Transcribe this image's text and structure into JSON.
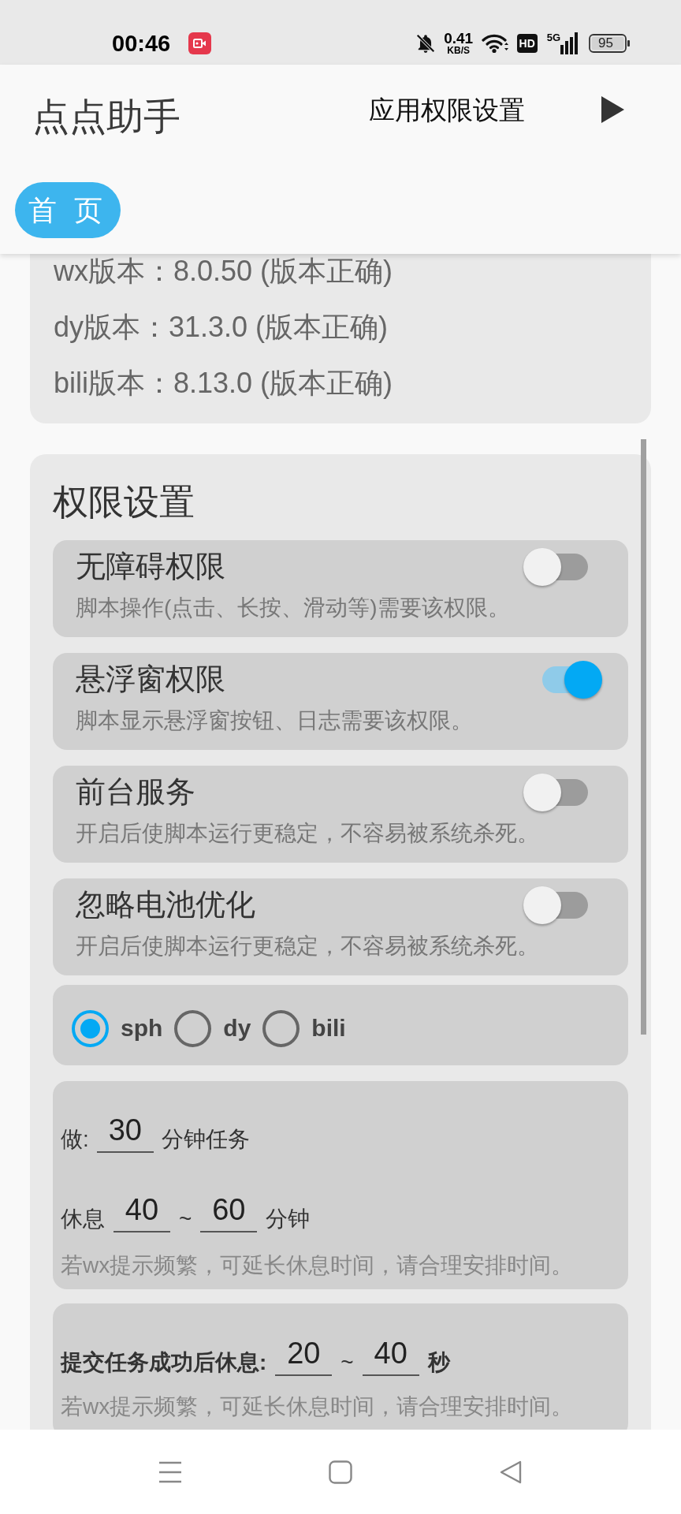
{
  "status_bar": {
    "time": "00:46",
    "net_speed": "0.41",
    "net_speed_unit": "KB/S",
    "hd": "HD",
    "network": "5G",
    "battery": "95"
  },
  "app_bar": {
    "title": "点点助手",
    "page_title": "应用权限设置"
  },
  "tabs": [
    {
      "label": "首 页",
      "selected": true
    }
  ],
  "versions": [
    "wx版本：8.0.50 (版本正确)",
    "dy版本：31.3.0 (版本正确)",
    "bili版本：8.13.0 (版本正确)"
  ],
  "permissions": {
    "title": "权限设置",
    "items": [
      {
        "title": "无障碍权限",
        "description": "脚本操作(点击、长按、滑动等)需要该权限。",
        "on": false
      },
      {
        "title": "悬浮窗权限",
        "description": "脚本显示悬浮窗按钮、日志需要该权限。",
        "on": true
      },
      {
        "title": "前台服务",
        "description": "开启后使脚本运行更稳定，不容易被系统杀死。",
        "on": false
      },
      {
        "title": "忽略电池优化",
        "description": "开启后使脚本运行更稳定，不容易被系统杀死。",
        "on": false
      }
    ]
  },
  "platforms": [
    {
      "label": "sph",
      "selected": true
    },
    {
      "label": "dy",
      "selected": false
    },
    {
      "label": "bili",
      "selected": false
    }
  ],
  "task_timer": {
    "work": {
      "label": "做:",
      "value": "30",
      "unit": "分钟任务"
    },
    "rest": {
      "label": "休息",
      "min": "40",
      "separator": "~",
      "max": "60",
      "unit": "分钟"
    },
    "hint": "若wx提示频繁，可延长休息时间，请合理安排时间。"
  },
  "submit_rest": {
    "label": "提交任务成功后休息:",
    "min": "20",
    "separator": "~",
    "max": "40",
    "unit": "秒",
    "hint": "若wx提示频繁，可延长休息时间，请合理安排时间。"
  }
}
